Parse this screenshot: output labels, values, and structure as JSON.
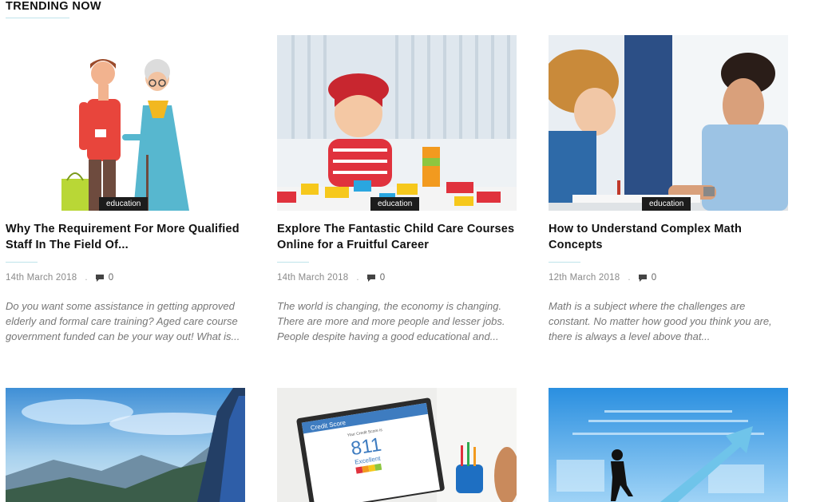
{
  "section": {
    "title": "TRENDING NOW"
  },
  "posts": [
    {
      "category": "education",
      "title": "Why The Requirement For More Qualified Staff In The Field Of...",
      "date": "14th March 2018",
      "comments": "0",
      "excerpt": "Do you want some assistance in getting approved elderly and formal care training? Aged care course government funded can be your way out! What is..."
    },
    {
      "category": "education",
      "title": "Explore The Fantastic Child Care Courses Online for a Fruitful Career",
      "date": "14th March 2018",
      "comments": "0",
      "excerpt": "The world is changing, the economy is changing. There are more and more people and lesser jobs. People despite having a good educational and..."
    },
    {
      "category": "education",
      "title": "How to Understand Complex Math Concepts",
      "date": "12th March 2018",
      "comments": "0",
      "excerpt": "Math is a subject where the challenges are constant. No matter how good you think you are, there is always a level above that..."
    }
  ],
  "credit_score": {
    "heading": "Credit Score",
    "sub": "Your Credit Score is",
    "value": "811",
    "rating": "Excellent"
  },
  "colors": {
    "accent_rule": "#bfe3ea",
    "badge_bg": "#1c1c1c"
  }
}
